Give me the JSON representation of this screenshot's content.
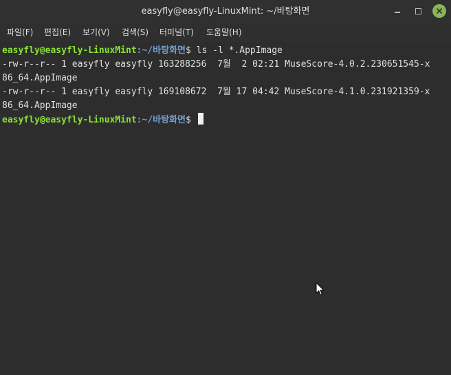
{
  "window": {
    "title": "easyfly@easyfly-LinuxMint: ~/바탕화면"
  },
  "menu": {
    "items": [
      {
        "label": "파일(F)"
      },
      {
        "label": "편집(E)"
      },
      {
        "label": "보기(V)"
      },
      {
        "label": "검색(S)"
      },
      {
        "label": "터미널(T)"
      },
      {
        "label": "도움말(H)"
      }
    ]
  },
  "terminal": {
    "prompt1": {
      "user": "easyfly@easyfly-LinuxMint",
      "path": ":~/바탕화면",
      "symbol": "$",
      "command": " ls -l *.AppImage"
    },
    "output": [
      "-rw-r--r-- 1 easyfly easyfly 163288256  7월  2 02:21 MuseScore-4.0.2.230651545-x",
      "86_64.AppImage",
      "-rw-r--r-- 1 easyfly easyfly 169108672  7월 17 04:42 MuseScore-4.1.0.231921359-x",
      "86_64.AppImage"
    ],
    "prompt2": {
      "user": "easyfly@easyfly-LinuxMint",
      "path": ":~/바탕화면",
      "symbol": "$"
    }
  },
  "colors": {
    "prompt_user": "#8ae234",
    "prompt_path": "#729fcf",
    "close_button": "#8ab556",
    "background": "#2d2d2d"
  },
  "icons": {
    "minimize": "minimize-icon",
    "maximize": "maximize-icon",
    "close": "close-icon",
    "pointer": "mouse-pointer-icon"
  }
}
